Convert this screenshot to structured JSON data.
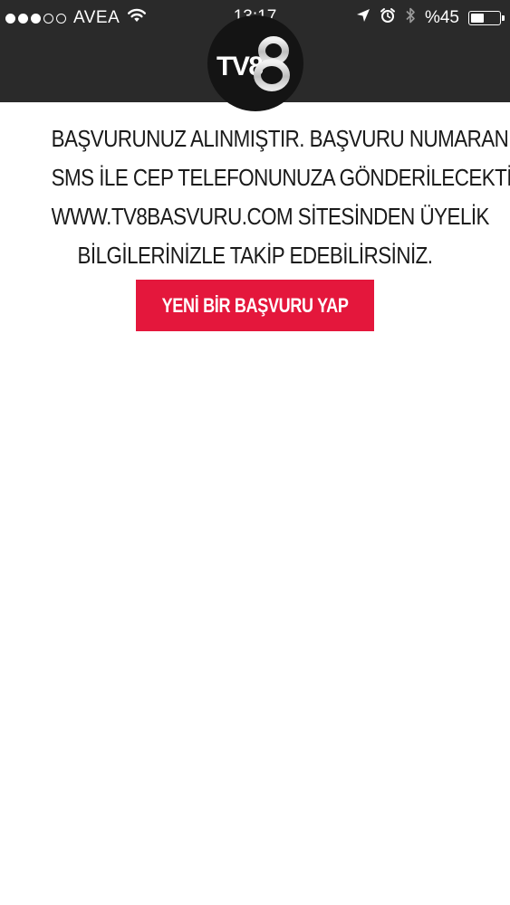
{
  "status_bar": {
    "signal_full": 3,
    "signal_total": 5,
    "carrier": "AVEA",
    "time": "13:17",
    "battery_percent_label": "%45",
    "battery_level": 0.45,
    "icons": [
      "wifi-icon",
      "location-arrow-icon",
      "alarm-icon",
      "bluetooth-icon",
      "battery-icon"
    ]
  },
  "header": {
    "logo": "TV8",
    "background": "#2a2a2a"
  },
  "main": {
    "message_lines": [
      "BAŞVURUNUZ ALINMIŞTIR. BAŞVURU NUMARANIZ",
      "SMS İLE CEP TELEFONUNUZA GÖNDERİLECEKTİR.",
      "WWW.TV8BASVURU.COM SİTESİNDEN ÜYELİK",
      "BİLGİLERİNİZLE TAKİP EDEBİLİRSİNİZ."
    ],
    "new_application_button": "YENİ BİR BAŞVURU YAP",
    "accent_color": "#e4173c"
  }
}
